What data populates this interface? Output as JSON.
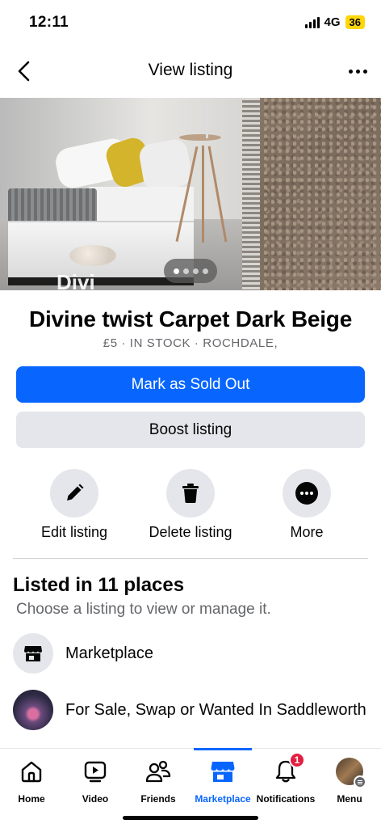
{
  "status_bar": {
    "time": "12:11",
    "network": "4G",
    "battery": "36"
  },
  "header": {
    "title": "View listing"
  },
  "carousel": {
    "total_dots": 4,
    "active_index": 0,
    "overlay_text": "Divi"
  },
  "listing": {
    "title": "Divine twist Carpet Dark Beige",
    "meta": "£5 · IN STOCK · ROCHDALE,"
  },
  "buttons": {
    "mark_sold": "Mark as Sold Out",
    "boost": "Boost listing"
  },
  "actions": {
    "edit": "Edit listing",
    "delete": "Delete listing",
    "more": "More"
  },
  "places": {
    "title": "Listed in 11 places",
    "subtitle": "Choose a listing to view or manage it.",
    "items": [
      {
        "label": "Marketplace",
        "icon": "store-icon"
      },
      {
        "label": "For Sale, Swap or Wanted In Saddleworth",
        "icon": "group-avatar"
      }
    ]
  },
  "nav": {
    "home": "Home",
    "video": "Video",
    "friends": "Friends",
    "marketplace": "Marketplace",
    "notifications": "Notifications",
    "notifications_badge": "1",
    "menu": "Menu",
    "active": "marketplace"
  },
  "colors": {
    "accent": "#0866ff",
    "secondary_button": "#e4e6eb",
    "badge": "#e41e3f",
    "muted_text": "#65676b"
  }
}
